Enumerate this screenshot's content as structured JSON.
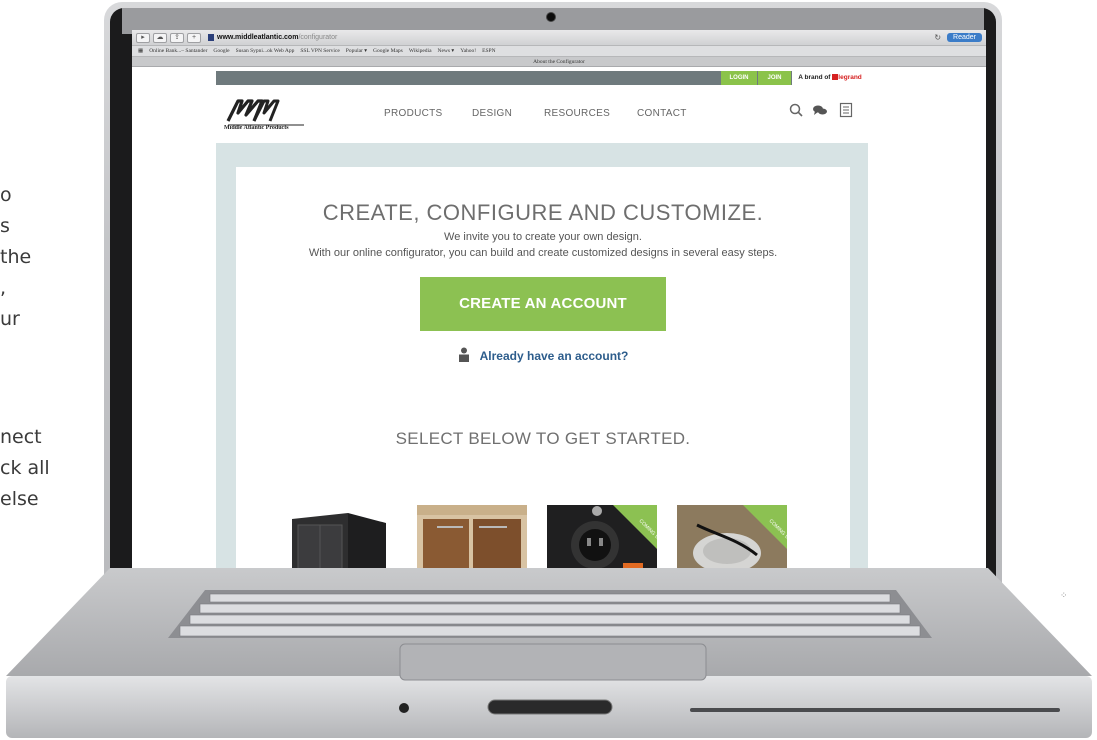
{
  "side_text": {
    "left_lines": [
      "o",
      "s",
      "the",
      ",",
      "ur"
    ],
    "left_lines2": [
      "nect",
      "ck all",
      " else"
    ]
  },
  "browser": {
    "url_domain": "www.middleatlantic.com",
    "url_path": "/configurator",
    "reader_label": "Reader",
    "bookmarks": [
      "Online Bank...– Santander",
      "Google",
      "Susan Sypni...ok Web App",
      "SSL VPN Service",
      "Popular ▾",
      "Google Maps",
      "Wikipedia",
      "News ▾",
      "Yahoo!",
      "ESPN"
    ],
    "tab_title": "About the Configurator"
  },
  "site": {
    "login": "LOGIN",
    "join": "JOIN",
    "brand_prefix": "A brand of",
    "brand_name": "legrand",
    "logo_text": "Middle Atlantic Products",
    "nav": [
      "PRODUCTS",
      "DESIGN",
      "RESOURCES",
      "CONTACT"
    ],
    "hero_title": "CREATE, CONFIGURE AND CUSTOMIZE.",
    "hero_sub1": "We invite you to create your own design.",
    "hero_sub2": "With our online configurator, you can build and create customized designs in several easy steps.",
    "cta": "CREATE AN ACCOUNT",
    "login_link": "Already have an account?",
    "select_title": "SELECT BELOW TO GET STARTED.",
    "coming_soon": "COMING SOON",
    "colors": {
      "accent": "#8cc152",
      "link": "#2d5d8c",
      "topbar": "#6f7a7d",
      "panel": "#d7e3e4"
    }
  }
}
